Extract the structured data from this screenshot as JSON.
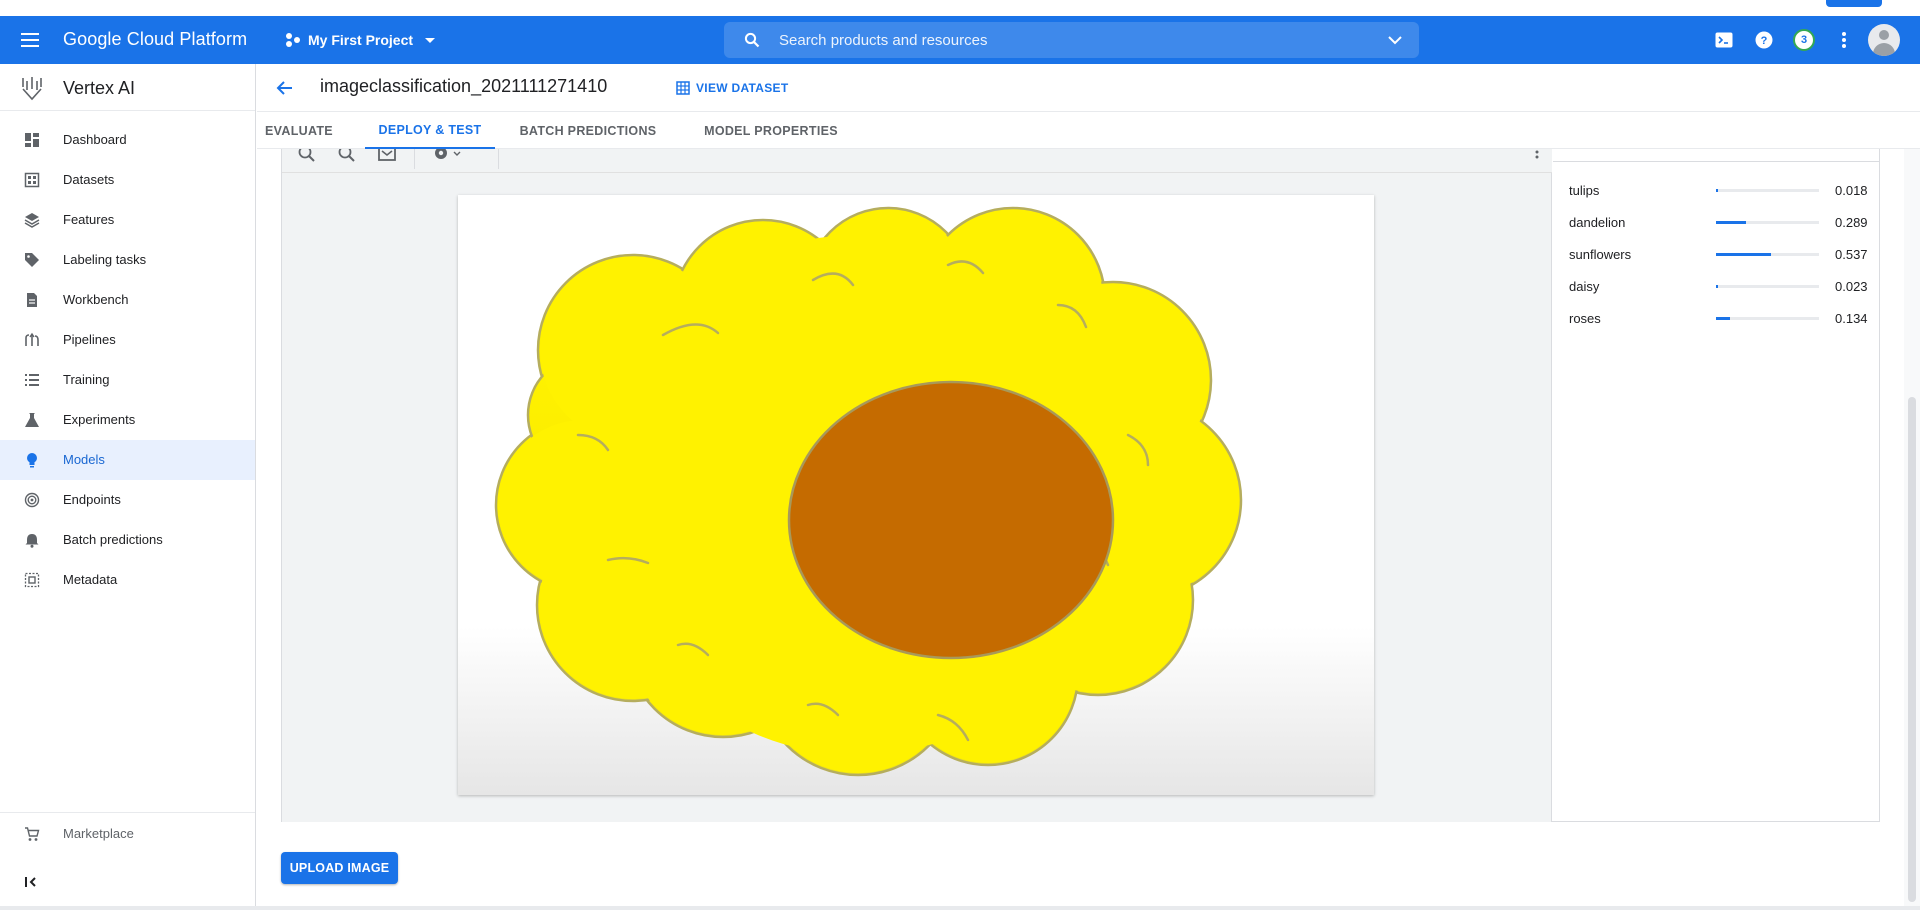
{
  "app": {
    "brand": "Google Cloud Platform",
    "project": "My First Project",
    "search_placeholder": "Search products and resources",
    "notification_count": "3",
    "accent_color": "#1a73e8"
  },
  "sidebar": {
    "product_name": "Vertex AI",
    "items": [
      {
        "label": "Dashboard",
        "icon": "dashboard-icon"
      },
      {
        "label": "Datasets",
        "icon": "datasets-icon"
      },
      {
        "label": "Features",
        "icon": "features-icon"
      },
      {
        "label": "Labeling tasks",
        "icon": "label-tag-icon"
      },
      {
        "label": "Workbench",
        "icon": "notebook-icon"
      },
      {
        "label": "Pipelines",
        "icon": "pipelines-icon"
      },
      {
        "label": "Training",
        "icon": "list-icon"
      },
      {
        "label": "Experiments",
        "icon": "flask-icon"
      },
      {
        "label": "Models",
        "icon": "lightbulb-icon",
        "active": true
      },
      {
        "label": "Endpoints",
        "icon": "target-icon"
      },
      {
        "label": "Batch predictions",
        "icon": "bell-icon"
      },
      {
        "label": "Metadata",
        "icon": "metadata-icon"
      }
    ],
    "marketplace": "Marketplace"
  },
  "header": {
    "title": "imageclassification_2021111271410",
    "view_dataset": "VIEW DATASET"
  },
  "tabs": [
    {
      "label": "EVALUATE"
    },
    {
      "label": "DEPLOY & TEST",
      "active": true
    },
    {
      "label": "BATCH PREDICTIONS"
    },
    {
      "label": "MODEL PROPERTIES"
    }
  ],
  "predictions": [
    {
      "label": "tulips",
      "score": "0.018",
      "fraction": 0.018
    },
    {
      "label": "dandelion",
      "score": "0.289",
      "fraction": 0.289
    },
    {
      "label": "sunflowers",
      "score": "0.537",
      "fraction": 0.537
    },
    {
      "label": "daisy",
      "score": "0.023",
      "fraction": 0.023
    },
    {
      "label": "roses",
      "score": "0.134",
      "fraction": 0.134
    }
  ],
  "upload_button": "UPLOAD IMAGE"
}
